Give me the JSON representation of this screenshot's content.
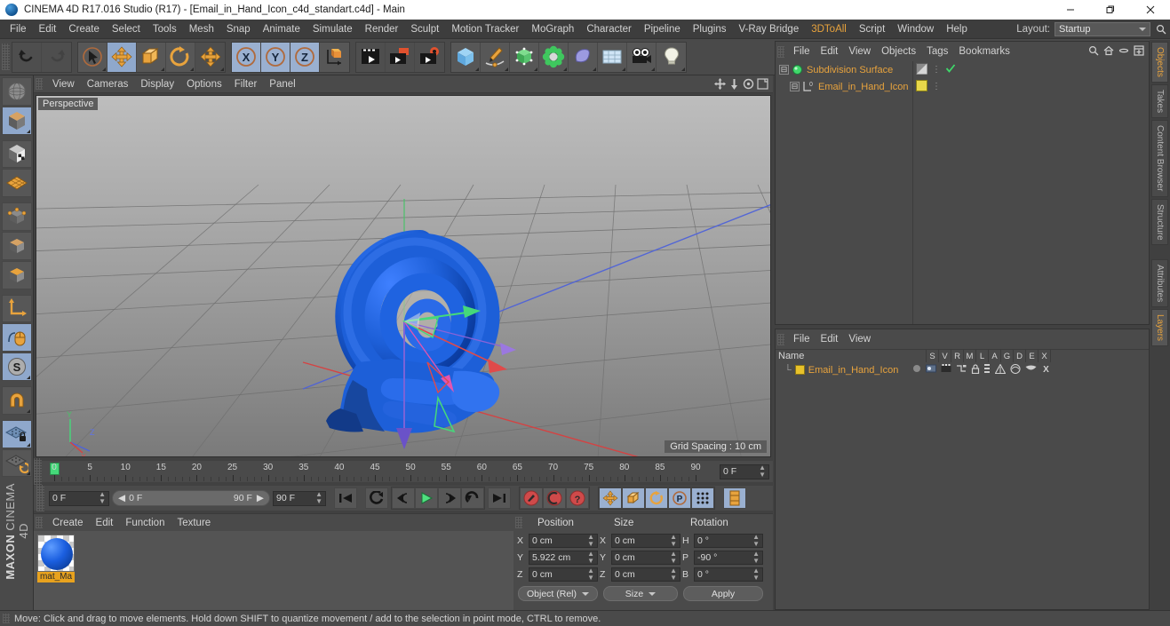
{
  "window": {
    "title": "CINEMA 4D R17.016 Studio (R17) - [Email_in_Hand_Icon_c4d_standart.c4d] - Main",
    "minimize": "—",
    "maximize": "❐",
    "close": "✕"
  },
  "menubar": {
    "items": [
      {
        "label": "File"
      },
      {
        "label": "Edit"
      },
      {
        "label": "Create"
      },
      {
        "label": "Select"
      },
      {
        "label": "Tools"
      },
      {
        "label": "Mesh"
      },
      {
        "label": "Snap"
      },
      {
        "label": "Animate"
      },
      {
        "label": "Simulate"
      },
      {
        "label": "Render"
      },
      {
        "label": "Sculpt"
      },
      {
        "label": "Motion Tracker"
      },
      {
        "label": "MoGraph"
      },
      {
        "label": "Character"
      },
      {
        "label": "Pipeline"
      },
      {
        "label": "Plugins"
      },
      {
        "label": "V-Ray Bridge"
      },
      {
        "label": "3DToAll"
      },
      {
        "label": "Script"
      },
      {
        "label": "Window"
      },
      {
        "label": "Help"
      }
    ],
    "layout_label": "Layout:",
    "layout_value": "Startup"
  },
  "viewport": {
    "menu": [
      "View",
      "Cameras",
      "Display",
      "Options",
      "Filter",
      "Panel"
    ],
    "perspective_label": "Perspective",
    "grid_spacing": "Grid Spacing : 10 cm",
    "model_name": "Email in Hand Icon",
    "model_color": "#1d5fd8"
  },
  "timeline": {
    "ticks": [
      0,
      5,
      10,
      15,
      20,
      25,
      30,
      35,
      40,
      45,
      50,
      55,
      60,
      65,
      70,
      75,
      80,
      85,
      90
    ],
    "start": 0,
    "end": 90,
    "current_frame_field": "0 F",
    "current_frame_left": "0 F",
    "range_start": "0 F",
    "range_end": "90 F",
    "end_frame_field": "90 F",
    "playhead_frame": 0
  },
  "objects_panel": {
    "menu": [
      "File",
      "Edit",
      "View",
      "Objects",
      "Tags",
      "Bookmarks"
    ],
    "icons": [
      "search-icon",
      "home-icon",
      "minimize-icon",
      "expand-icon"
    ],
    "items": [
      {
        "name": "Subdivision Surface",
        "type": "subdivision-surface",
        "has_check": true
      },
      {
        "name": "Email_in_Hand_Icon",
        "type": "object",
        "has_check": false
      }
    ]
  },
  "layers_panel": {
    "menu": [
      "File",
      "Edit",
      "View"
    ],
    "columns": [
      "Name",
      "S",
      "V",
      "R",
      "M",
      "L",
      "A",
      "G",
      "D",
      "E",
      "X"
    ],
    "rows": [
      {
        "name": "Email_in_Hand_Icon",
        "color": "#e8c22a"
      }
    ]
  },
  "materials_panel": {
    "menu": [
      "Create",
      "Edit",
      "Function",
      "Texture"
    ],
    "materials": [
      {
        "name": "mat_Ma",
        "color": "#1d5fd8"
      }
    ]
  },
  "coordinates_panel": {
    "headers": [
      "Position",
      "Size",
      "Rotation"
    ],
    "position": {
      "x_label": "X",
      "x": "0 cm",
      "y_label": "Y",
      "y": "5.922 cm",
      "z_label": "Z",
      "z": "0 cm"
    },
    "size": {
      "x_label": "X",
      "x": "0 cm",
      "y_label": "Y",
      "y": "0 cm",
      "z_label": "Z",
      "z": "0 cm"
    },
    "rotation": {
      "h_label": "H",
      "h": "0 °",
      "p_label": "P",
      "p": "-90 °",
      "b_label": "B",
      "b": "0 °"
    },
    "mode_dropdown": "Object (Rel)",
    "size_dropdown": "Size",
    "apply_button": "Apply"
  },
  "right_tabs": [
    {
      "label": "Objects",
      "active": true
    },
    {
      "label": "Takes",
      "active": false
    },
    {
      "label": "Content Browser",
      "active": false
    },
    {
      "label": "Structure",
      "active": false
    },
    {
      "label": "Attributes",
      "active": false
    },
    {
      "label": "Layers",
      "active": true
    }
  ],
  "statusbar": {
    "text": "Move: Click and drag to move elements. Hold down SHIFT to quantize movement / add to the selection in point mode, CTRL to remove."
  },
  "colors": {
    "accent_orange": "#e8a33d",
    "panel_bg": "#4a4a4a",
    "toolbar_bg": "#4a4a4a",
    "selected_blue": "#8fa8cc",
    "model_blue": "#1d5fd8"
  }
}
